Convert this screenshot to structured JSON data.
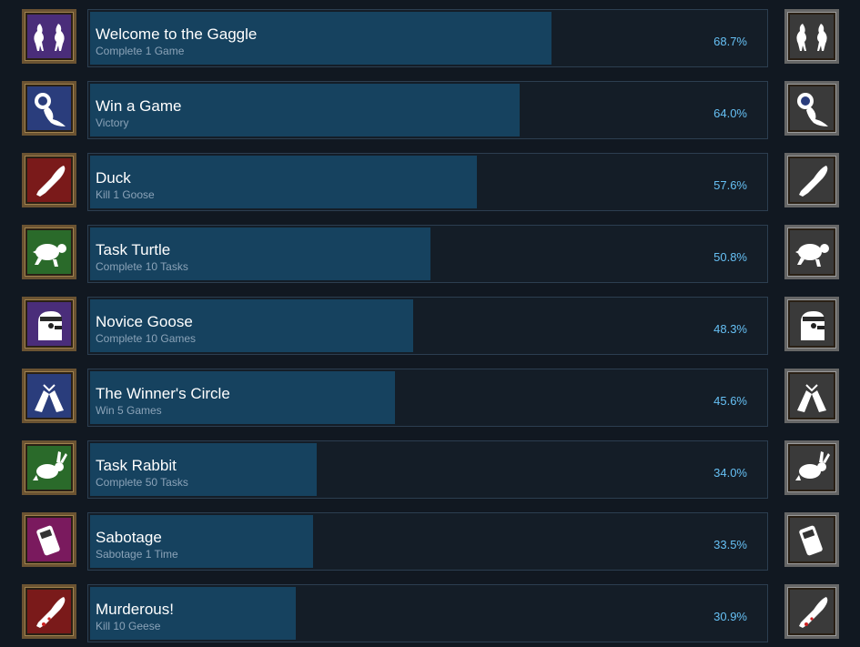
{
  "achievements": [
    {
      "title": "Welcome to the Gaggle",
      "desc": "Complete 1 Game",
      "percent_text": "68.7%",
      "percent": 68.7,
      "color": "#4a2d7a",
      "icon": "two-geese-icon"
    },
    {
      "title": "Win a Game",
      "desc": "Victory",
      "percent_text": "64.0%",
      "percent": 64.0,
      "color": "#2a3d7c",
      "icon": "ribbon-icon"
    },
    {
      "title": "Duck",
      "desc": "Kill 1 Goose",
      "percent_text": "57.6%",
      "percent": 57.6,
      "color": "#7a1a1a",
      "icon": "knife-icon"
    },
    {
      "title": "Task Turtle",
      "desc": "Complete 10 Tasks",
      "percent_text": "50.8%",
      "percent": 50.8,
      "color": "#2a6a2a",
      "icon": "turtle-icon"
    },
    {
      "title": "Novice Goose",
      "desc": "Complete 10 Games",
      "percent_text": "48.3%",
      "percent": 48.3,
      "color": "#4a2d7a",
      "icon": "goose-helmet-icon"
    },
    {
      "title": "The Winner's Circle",
      "desc": "Win 5 Games",
      "percent_text": "45.6%",
      "percent": 45.6,
      "color": "#2a3d7c",
      "icon": "toast-icon"
    },
    {
      "title": "Task Rabbit",
      "desc": "Complete 50 Tasks",
      "percent_text": "34.0%",
      "percent": 34.0,
      "color": "#2a6a2a",
      "icon": "rabbit-icon"
    },
    {
      "title": "Sabotage",
      "desc": "Sabotage 1 Time",
      "percent_text": "33.5%",
      "percent": 33.5,
      "color": "#7a1a5e",
      "icon": "remote-icon"
    },
    {
      "title": "Murderous!",
      "desc": "Kill 10 Geese",
      "percent_text": "30.9%",
      "percent": 30.9,
      "color": "#7a1a1a",
      "icon": "bloody-knife-icon"
    }
  ]
}
